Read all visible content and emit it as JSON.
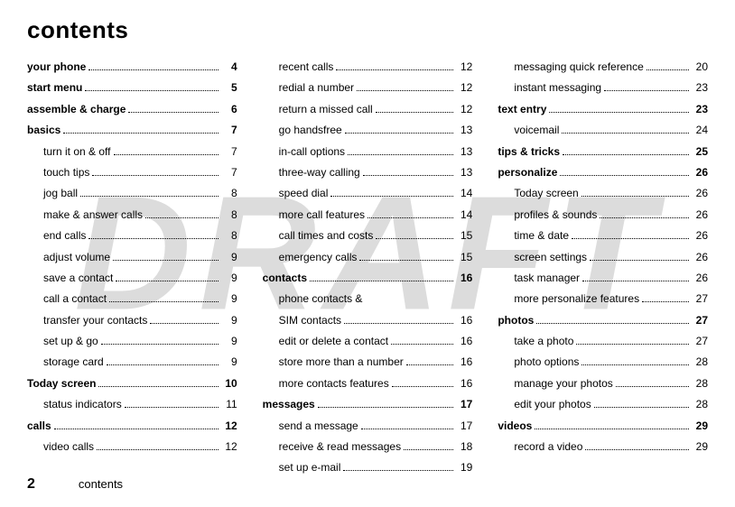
{
  "title": "contents",
  "watermark": "DRAFT",
  "footer": {
    "page": "2",
    "section": "contents"
  },
  "columns": [
    [
      {
        "level": 1,
        "label": "your phone",
        "page": "4"
      },
      {
        "level": 1,
        "label": "start menu",
        "page": "5"
      },
      {
        "level": 1,
        "label": "assemble & charge",
        "page": "6"
      },
      {
        "level": 1,
        "label": "basics",
        "page": "7"
      },
      {
        "level": 2,
        "label": "turn it on & off",
        "page": "7"
      },
      {
        "level": 2,
        "label": "touch tips",
        "page": "7"
      },
      {
        "level": 2,
        "label": "jog ball",
        "page": "8"
      },
      {
        "level": 2,
        "label": "make & answer calls",
        "page": "8"
      },
      {
        "level": 2,
        "label": "end calls",
        "page": "8"
      },
      {
        "level": 2,
        "label": "adjust volume",
        "page": "9"
      },
      {
        "level": 2,
        "label": "save a contact",
        "page": "9"
      },
      {
        "level": 2,
        "label": "call a contact",
        "page": "9"
      },
      {
        "level": 2,
        "label": "transfer your contacts",
        "page": "9"
      },
      {
        "level": 2,
        "label": "set up & go",
        "page": "9"
      },
      {
        "level": 2,
        "label": "storage card",
        "page": "9"
      },
      {
        "level": 1,
        "label": "Today screen",
        "page": "10"
      },
      {
        "level": 2,
        "label": "status indicators",
        "page": "11"
      },
      {
        "level": 1,
        "label": "calls",
        "page": "12"
      },
      {
        "level": 2,
        "label": "video calls",
        "page": "12"
      }
    ],
    [
      {
        "level": 2,
        "label": "recent calls",
        "page": "12"
      },
      {
        "level": 2,
        "label": "redial a number",
        "page": "12"
      },
      {
        "level": 2,
        "label": "return a missed call",
        "page": "12"
      },
      {
        "level": 2,
        "label": "go handsfree",
        "page": "13"
      },
      {
        "level": 2,
        "label": "in-call options",
        "page": "13"
      },
      {
        "level": 2,
        "label": "three-way calling",
        "page": "13"
      },
      {
        "level": 2,
        "label": "speed dial",
        "page": "14"
      },
      {
        "level": 2,
        "label": "more call features",
        "page": "14"
      },
      {
        "level": 2,
        "label": "call times and costs",
        "page": "15"
      },
      {
        "level": 2,
        "label": "emergency calls",
        "page": "15"
      },
      {
        "level": 1,
        "label": "contacts",
        "page": "16"
      },
      {
        "level": 2,
        "label": "phone contacts &",
        "page": ""
      },
      {
        "level": "2cont",
        "label": "SIM contacts",
        "page": "16"
      },
      {
        "level": 2,
        "label": "edit or delete a contact",
        "page": "16"
      },
      {
        "level": 2,
        "label": "store more than a number",
        "page": "16"
      },
      {
        "level": 2,
        "label": "more contacts features",
        "page": "16"
      },
      {
        "level": 1,
        "label": "messages",
        "page": "17"
      },
      {
        "level": 2,
        "label": "send a message",
        "page": "17"
      },
      {
        "level": 2,
        "label": "receive & read messages",
        "page": "18"
      },
      {
        "level": 2,
        "label": "set up e-mail",
        "page": "19"
      }
    ],
    [
      {
        "level": 2,
        "label": "messaging quick reference",
        "page": "20"
      },
      {
        "level": 2,
        "label": "instant messaging",
        "page": "23"
      },
      {
        "level": 1,
        "label": "text entry",
        "page": "23"
      },
      {
        "level": 2,
        "label": "voicemail",
        "page": "24"
      },
      {
        "level": 1,
        "label": "tips & tricks",
        "page": "25"
      },
      {
        "level": 1,
        "label": "personalize",
        "page": "26"
      },
      {
        "level": 2,
        "label": "Today screen",
        "page": "26"
      },
      {
        "level": 2,
        "label": "profiles & sounds",
        "page": "26"
      },
      {
        "level": 2,
        "label": "time & date",
        "page": "26"
      },
      {
        "level": 2,
        "label": "screen settings",
        "page": "26"
      },
      {
        "level": 2,
        "label": "task manager",
        "page": "26"
      },
      {
        "level": 2,
        "label": "more personalize features",
        "page": "27"
      },
      {
        "level": 1,
        "label": "photos",
        "page": "27"
      },
      {
        "level": 2,
        "label": "take a photo",
        "page": "27"
      },
      {
        "level": 2,
        "label": "photo options",
        "page": "28"
      },
      {
        "level": 2,
        "label": "manage your photos",
        "page": "28"
      },
      {
        "level": 2,
        "label": "edit your photos",
        "page": "28"
      },
      {
        "level": 1,
        "label": "videos",
        "page": "29"
      },
      {
        "level": 2,
        "label": "record a video",
        "page": "29"
      }
    ]
  ]
}
